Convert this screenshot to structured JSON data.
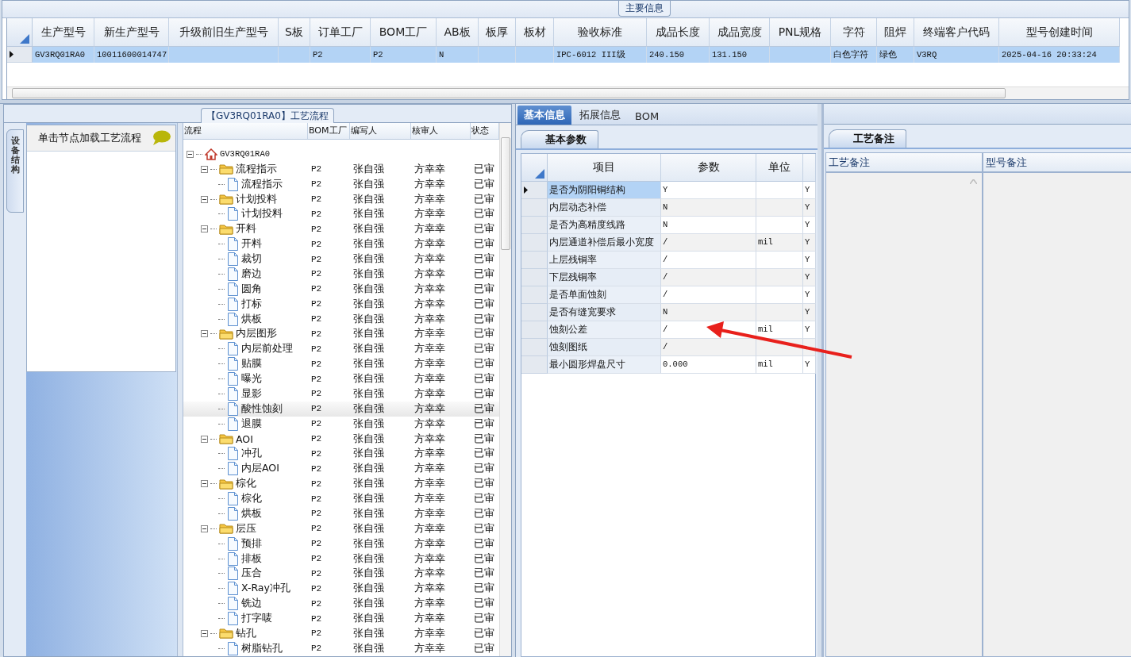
{
  "main_info": {
    "title": "主要信息",
    "columns": [
      "生产型号",
      "新生产型号",
      "升级前旧生产型号",
      "S板",
      "订单工厂",
      "BOM工厂",
      "AB板",
      "板厚",
      "板材",
      "验收标准",
      "成品长度",
      "成品宽度",
      "PNL规格",
      "字符",
      "阻焊",
      "终端客户代码",
      "型号创建时间"
    ],
    "rows": [
      {
        "selected": true,
        "cells": [
          "GV3RQ01RA0",
          "10011600014747",
          "",
          "",
          "P2",
          "P2",
          "N",
          "",
          "",
          "IPC-6012 III级",
          "240.150",
          "131.150",
          "",
          "白色字符",
          "绿色",
          "V3RQ",
          "2025-04-16 20:33:24"
        ]
      }
    ]
  },
  "process_panel": {
    "title": "【GV3RQ01RA0】工艺流程",
    "side_tab": "设备结构",
    "hint": "单击节点加载工艺流程",
    "tree": {
      "columns": [
        "流程",
        "BOM工厂",
        "编写人",
        "核审人",
        "状态"
      ],
      "nodes": [
        {
          "label": "GV3RQ01RA0",
          "kind": "root",
          "expanded": true,
          "selected": false,
          "children": [
            {
              "label": "流程指示",
              "kind": "folder",
              "expanded": true,
              "selected": false,
              "bom": "P2",
              "writer": "张自强",
              "reviewer": "方幸幸",
              "status": "已审",
              "children": [
                {
                  "label": "流程指示",
                  "kind": "step",
                  "selected": false,
                  "bom": "P2",
                  "writer": "张自强",
                  "reviewer": "方幸幸",
                  "status": "已审"
                }
              ]
            },
            {
              "label": "计划投料",
              "kind": "folder",
              "expanded": true,
              "selected": false,
              "bom": "P2",
              "writer": "张自强",
              "reviewer": "方幸幸",
              "status": "已审",
              "children": [
                {
                  "label": "计划投料",
                  "kind": "step",
                  "selected": false,
                  "bom": "P2",
                  "writer": "张自强",
                  "reviewer": "方幸幸",
                  "status": "已审"
                }
              ]
            },
            {
              "label": "开料",
              "kind": "folder",
              "expanded": true,
              "selected": false,
              "bom": "P2",
              "writer": "张自强",
              "reviewer": "方幸幸",
              "status": "已审",
              "children": [
                {
                  "label": "开料",
                  "kind": "step",
                  "selected": false,
                  "bom": "P2",
                  "writer": "张自强",
                  "reviewer": "方幸幸",
                  "status": "已审"
                },
                {
                  "label": "裁切",
                  "kind": "step",
                  "selected": false,
                  "bom": "P2",
                  "writer": "张自强",
                  "reviewer": "方幸幸",
                  "status": "已审"
                },
                {
                  "label": "磨边",
                  "kind": "step",
                  "selected": false,
                  "bom": "P2",
                  "writer": "张自强",
                  "reviewer": "方幸幸",
                  "status": "已审"
                },
                {
                  "label": "圆角",
                  "kind": "step",
                  "selected": false,
                  "bom": "P2",
                  "writer": "张自强",
                  "reviewer": "方幸幸",
                  "status": "已审"
                },
                {
                  "label": "打标",
                  "kind": "step",
                  "selected": false,
                  "bom": "P2",
                  "writer": "张自强",
                  "reviewer": "方幸幸",
                  "status": "已审"
                },
                {
                  "label": "烘板",
                  "kind": "step",
                  "selected": false,
                  "bom": "P2",
                  "writer": "张自强",
                  "reviewer": "方幸幸",
                  "status": "已审"
                }
              ]
            },
            {
              "label": "内层图形",
              "kind": "folder",
              "expanded": true,
              "selected": false,
              "bom": "P2",
              "writer": "张自强",
              "reviewer": "方幸幸",
              "status": "已审",
              "children": [
                {
                  "label": "内层前处理",
                  "kind": "step",
                  "selected": false,
                  "bom": "P2",
                  "writer": "张自强",
                  "reviewer": "方幸幸",
                  "status": "已审"
                },
                {
                  "label": "贴膜",
                  "kind": "step",
                  "selected": false,
                  "bom": "P2",
                  "writer": "张自强",
                  "reviewer": "方幸幸",
                  "status": "已审"
                },
                {
                  "label": "曝光",
                  "kind": "step",
                  "selected": false,
                  "bom": "P2",
                  "writer": "张自强",
                  "reviewer": "方幸幸",
                  "status": "已审"
                },
                {
                  "label": "显影",
                  "kind": "step",
                  "selected": false,
                  "bom": "P2",
                  "writer": "张自强",
                  "reviewer": "方幸幸",
                  "status": "已审"
                },
                {
                  "label": "酸性蚀刻",
                  "kind": "step",
                  "selected": true,
                  "bom": "P2",
                  "writer": "张自强",
                  "reviewer": "方幸幸",
                  "status": "已审"
                },
                {
                  "label": "退膜",
                  "kind": "step",
                  "selected": false,
                  "bom": "P2",
                  "writer": "张自强",
                  "reviewer": "方幸幸",
                  "status": "已审"
                }
              ]
            },
            {
              "label": "AOI",
              "kind": "folder",
              "expanded": true,
              "selected": false,
              "bom": "P2",
              "writer": "张自强",
              "reviewer": "方幸幸",
              "status": "已审",
              "children": [
                {
                  "label": "冲孔",
                  "kind": "step",
                  "selected": false,
                  "bom": "P2",
                  "writer": "张自强",
                  "reviewer": "方幸幸",
                  "status": "已审"
                },
                {
                  "label": "内层AOI",
                  "kind": "step",
                  "selected": false,
                  "bom": "P2",
                  "writer": "张自强",
                  "reviewer": "方幸幸",
                  "status": "已审"
                }
              ]
            },
            {
              "label": "棕化",
              "kind": "folder",
              "expanded": true,
              "selected": false,
              "bom": "P2",
              "writer": "张自强",
              "reviewer": "方幸幸",
              "status": "已审",
              "children": [
                {
                  "label": "棕化",
                  "kind": "step",
                  "selected": false,
                  "bom": "P2",
                  "writer": "张自强",
                  "reviewer": "方幸幸",
                  "status": "已审"
                },
                {
                  "label": "烘板",
                  "kind": "step",
                  "selected": false,
                  "bom": "P2",
                  "writer": "张自强",
                  "reviewer": "方幸幸",
                  "status": "已审"
                }
              ]
            },
            {
              "label": "层压",
              "kind": "folder",
              "expanded": true,
              "selected": false,
              "bom": "P2",
              "writer": "张自强",
              "reviewer": "方幸幸",
              "status": "已审",
              "children": [
                {
                  "label": "预排",
                  "kind": "step",
                  "selected": false,
                  "bom": "P2",
                  "writer": "张自强",
                  "reviewer": "方幸幸",
                  "status": "已审"
                },
                {
                  "label": "排板",
                  "kind": "step",
                  "selected": false,
                  "bom": "P2",
                  "writer": "张自强",
                  "reviewer": "方幸幸",
                  "status": "已审"
                },
                {
                  "label": "压合",
                  "kind": "step",
                  "selected": false,
                  "bom": "P2",
                  "writer": "张自强",
                  "reviewer": "方幸幸",
                  "status": "已审"
                },
                {
                  "label": "X-Ray冲孔",
                  "kind": "step",
                  "selected": false,
                  "bom": "P2",
                  "writer": "张自强",
                  "reviewer": "方幸幸",
                  "status": "已审"
                },
                {
                  "label": "铣边",
                  "kind": "step",
                  "selected": false,
                  "bom": "P2",
                  "writer": "张自强",
                  "reviewer": "方幸幸",
                  "status": "已审"
                },
                {
                  "label": "打字唛",
                  "kind": "step",
                  "selected": false,
                  "bom": "P2",
                  "writer": "张自强",
                  "reviewer": "方幸幸",
                  "status": "已审"
                }
              ]
            },
            {
              "label": "钻孔",
              "kind": "folder",
              "expanded": true,
              "selected": false,
              "bom": "P2",
              "writer": "张自强",
              "reviewer": "方幸幸",
              "status": "已审",
              "children": [
                {
                  "label": "树脂钻孔",
                  "kind": "step",
                  "selected": false,
                  "bom": "P2",
                  "writer": "张自强",
                  "reviewer": "方幸幸",
                  "status": "已审"
                }
              ]
            }
          ]
        }
      ]
    }
  },
  "detail": {
    "tabs": [
      {
        "label": "基本信息",
        "selected": true
      },
      {
        "label": "拓展信息",
        "selected": false
      },
      {
        "label": "BOM",
        "selected": false
      }
    ],
    "sub_tab": "基本参数",
    "params": {
      "columns": [
        "项目",
        "参数",
        "单位"
      ],
      "rows": [
        {
          "item": "是否为阴阳铜结构",
          "value": "Y",
          "unit": "",
          "flag": "Y",
          "selected": true
        },
        {
          "item": "内层动态补偿",
          "value": "N",
          "unit": "",
          "flag": "Y",
          "selected": false
        },
        {
          "item": "是否为高精度线路",
          "value": "N",
          "unit": "",
          "flag": "Y",
          "selected": false
        },
        {
          "item": "内层通道补偿后最小宽度",
          "value": "/",
          "unit": "mil",
          "flag": "Y",
          "selected": false
        },
        {
          "item": "上层残铜率",
          "value": "/",
          "unit": "",
          "flag": "Y",
          "selected": false
        },
        {
          "item": "下层残铜率",
          "value": "/",
          "unit": "",
          "flag": "Y",
          "selected": false
        },
        {
          "item": "是否单面蚀刻",
          "value": "/",
          "unit": "",
          "flag": "Y",
          "selected": false
        },
        {
          "item": "是否有缝宽要求",
          "value": "N",
          "unit": "",
          "flag": "Y",
          "selected": false
        },
        {
          "item": "蚀刻公差",
          "value": "/",
          "unit": "mil",
          "flag": "Y",
          "selected": false
        },
        {
          "item": "蚀刻图纸",
          "value": "/",
          "unit": "",
          "selected": false
        },
        {
          "item": "最小圆形焊盘尺寸",
          "value": "0.000",
          "unit": "mil",
          "flag": "Y",
          "selected": false
        }
      ]
    }
  },
  "remarks": {
    "tab": "工艺备注",
    "columns": [
      "工艺备注",
      "型号备注"
    ]
  },
  "annotation": {
    "kind": "arrow"
  }
}
